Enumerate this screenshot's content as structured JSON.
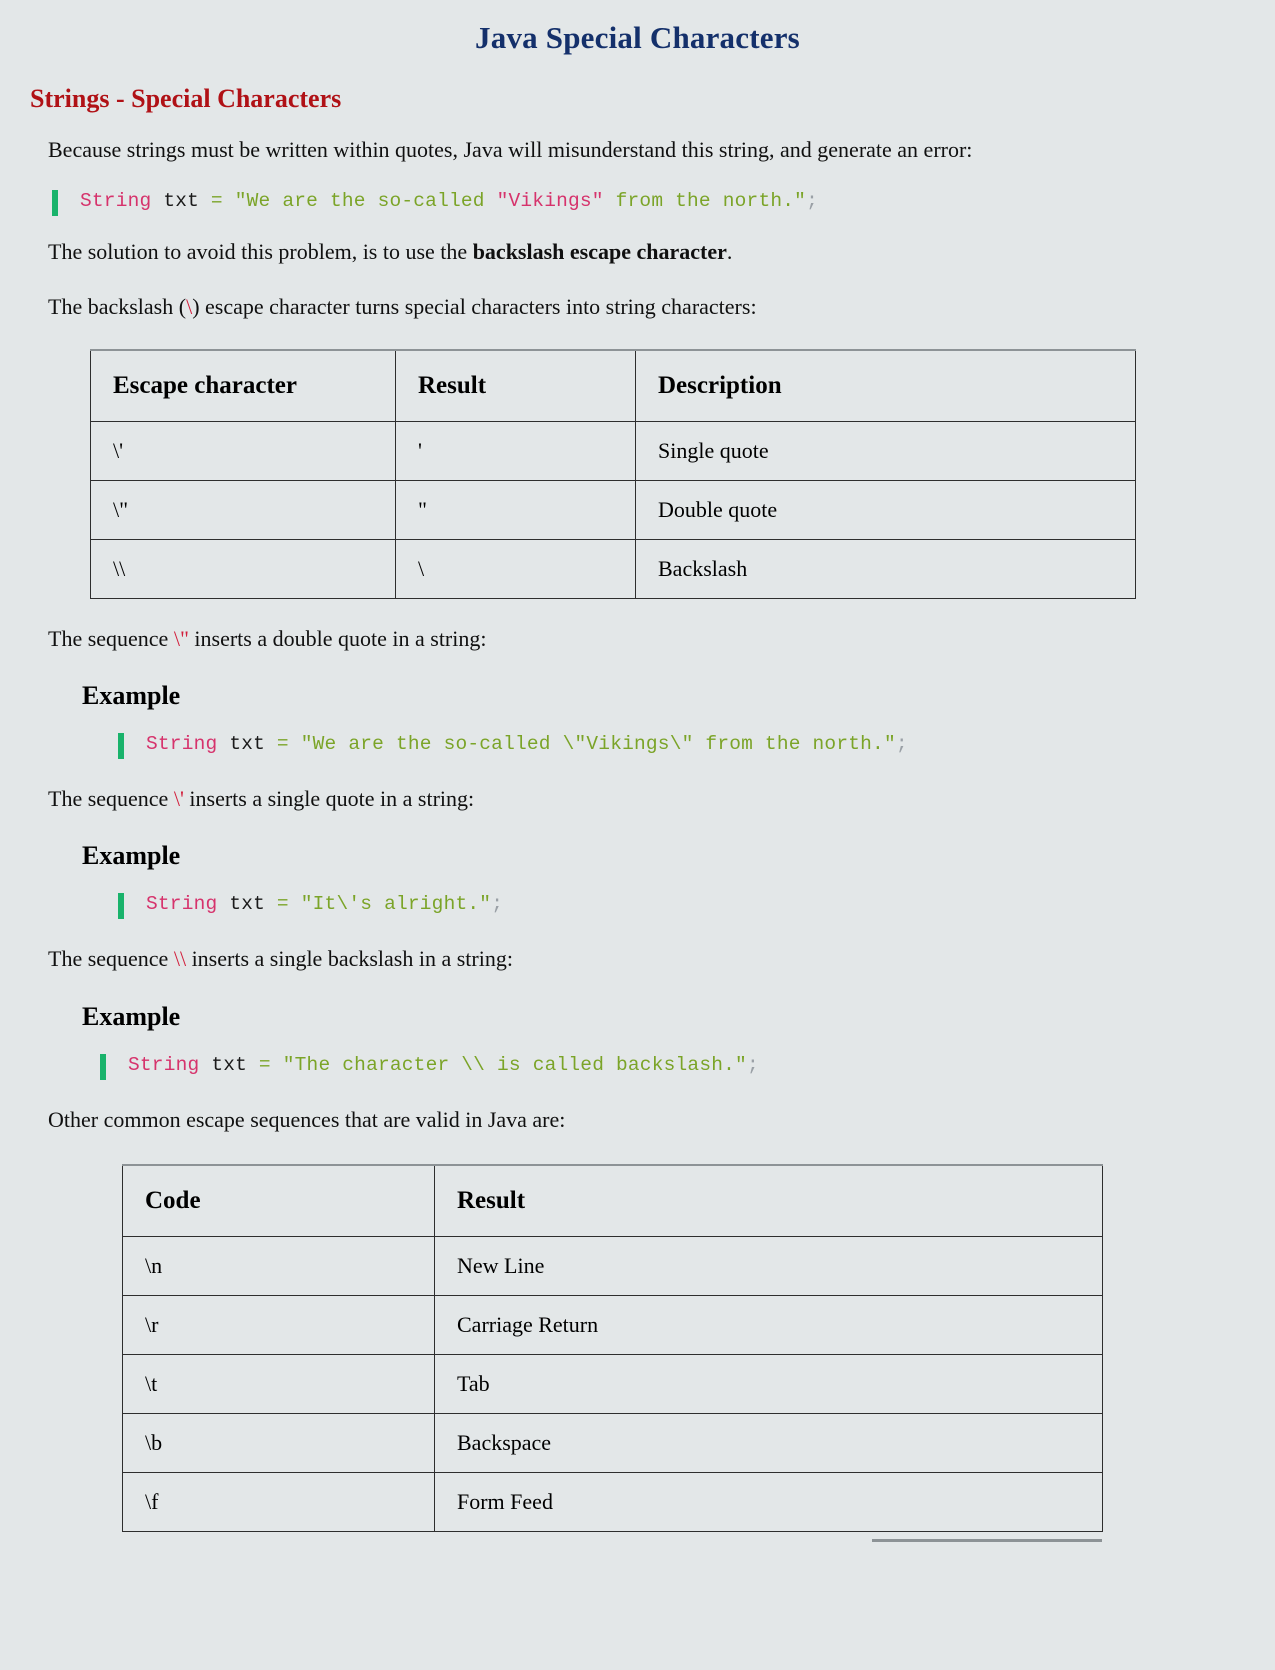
{
  "document": {
    "title": "Java Special Characters",
    "section_heading": "Strings - Special Characters",
    "intro_paragraph": "Because strings must be written within quotes, Java will misunderstand this string, and generate an error:",
    "solution_text_before": "The solution to avoid this problem, is to use the ",
    "solution_bold": "backslash escape character",
    "solution_text_after": ".",
    "escape_intro_before": "The backslash (",
    "escape_intro_code": "\\",
    "escape_intro_after": ") escape character turns special characters into string characters:",
    "other_sequences_text": "Other common escape sequences that are valid in Java are:"
  },
  "code_blocks": {
    "block1": {
      "keyword": "String",
      "variable": " txt",
      "operator": " = ",
      "string_part1": "\"We are the so-called ",
      "highlight": "\"Vikings\"",
      "string_part2": " from the north.\"",
      "semicolon": ";"
    },
    "block2": {
      "keyword": "String",
      "variable": " txt",
      "operator": " = ",
      "string": "\"We are the so-called \\\"Vikings\\\" from the north.\"",
      "semicolon": ";"
    },
    "block3": {
      "keyword": "String",
      "variable": " txt",
      "operator": " = ",
      "string": "\"It\\'s alright.\"",
      "semicolon": ";"
    },
    "block4": {
      "keyword": "String",
      "variable": " txt",
      "operator": " = ",
      "string": "\"The character \\\\ is called backslash.\"",
      "semicolon": ";"
    }
  },
  "sequence_paragraphs": {
    "double_quote": {
      "before": "The sequence ",
      "code": "\\\"",
      "after": "  inserts a double quote in a string:"
    },
    "single_quote": {
      "before": "The sequence ",
      "code": "\\'",
      "after": "  inserts a single quote in a string:"
    },
    "backslash": {
      "before": "The sequence ",
      "code": "\\\\",
      "after": "  inserts a single backslash in a string:"
    }
  },
  "example_labels": {
    "one": "Example",
    "two": "Example",
    "three": "Example"
  },
  "escape_table": {
    "headers": [
      "Escape character",
      "Result",
      "Description"
    ],
    "rows": [
      {
        "escape": "\\'",
        "result": "'",
        "description": "Single quote"
      },
      {
        "escape": "\\\"",
        "result": "\"",
        "description": "Double quote"
      },
      {
        "escape": "\\\\",
        "result": "\\",
        "description": "Backslash"
      }
    ]
  },
  "sequences_table": {
    "headers": [
      "Code",
      "Result"
    ],
    "rows": [
      {
        "code": "\\n",
        "result": "New Line"
      },
      {
        "code": "\\r",
        "result": "Carriage Return"
      },
      {
        "code": "\\t",
        "result": "Tab"
      },
      {
        "code": "\\b",
        "result": "Backspace"
      },
      {
        "code": "\\f",
        "result": "Form Feed"
      }
    ]
  },
  "colors": {
    "page_background": "#e3e7e8",
    "title": "#14306b",
    "section_heading": "#b01116",
    "code_accent_bar": "#19b36b",
    "code_keyword": "#d6336c",
    "code_string": "#7ba428",
    "inline_code": "#c1174b"
  }
}
